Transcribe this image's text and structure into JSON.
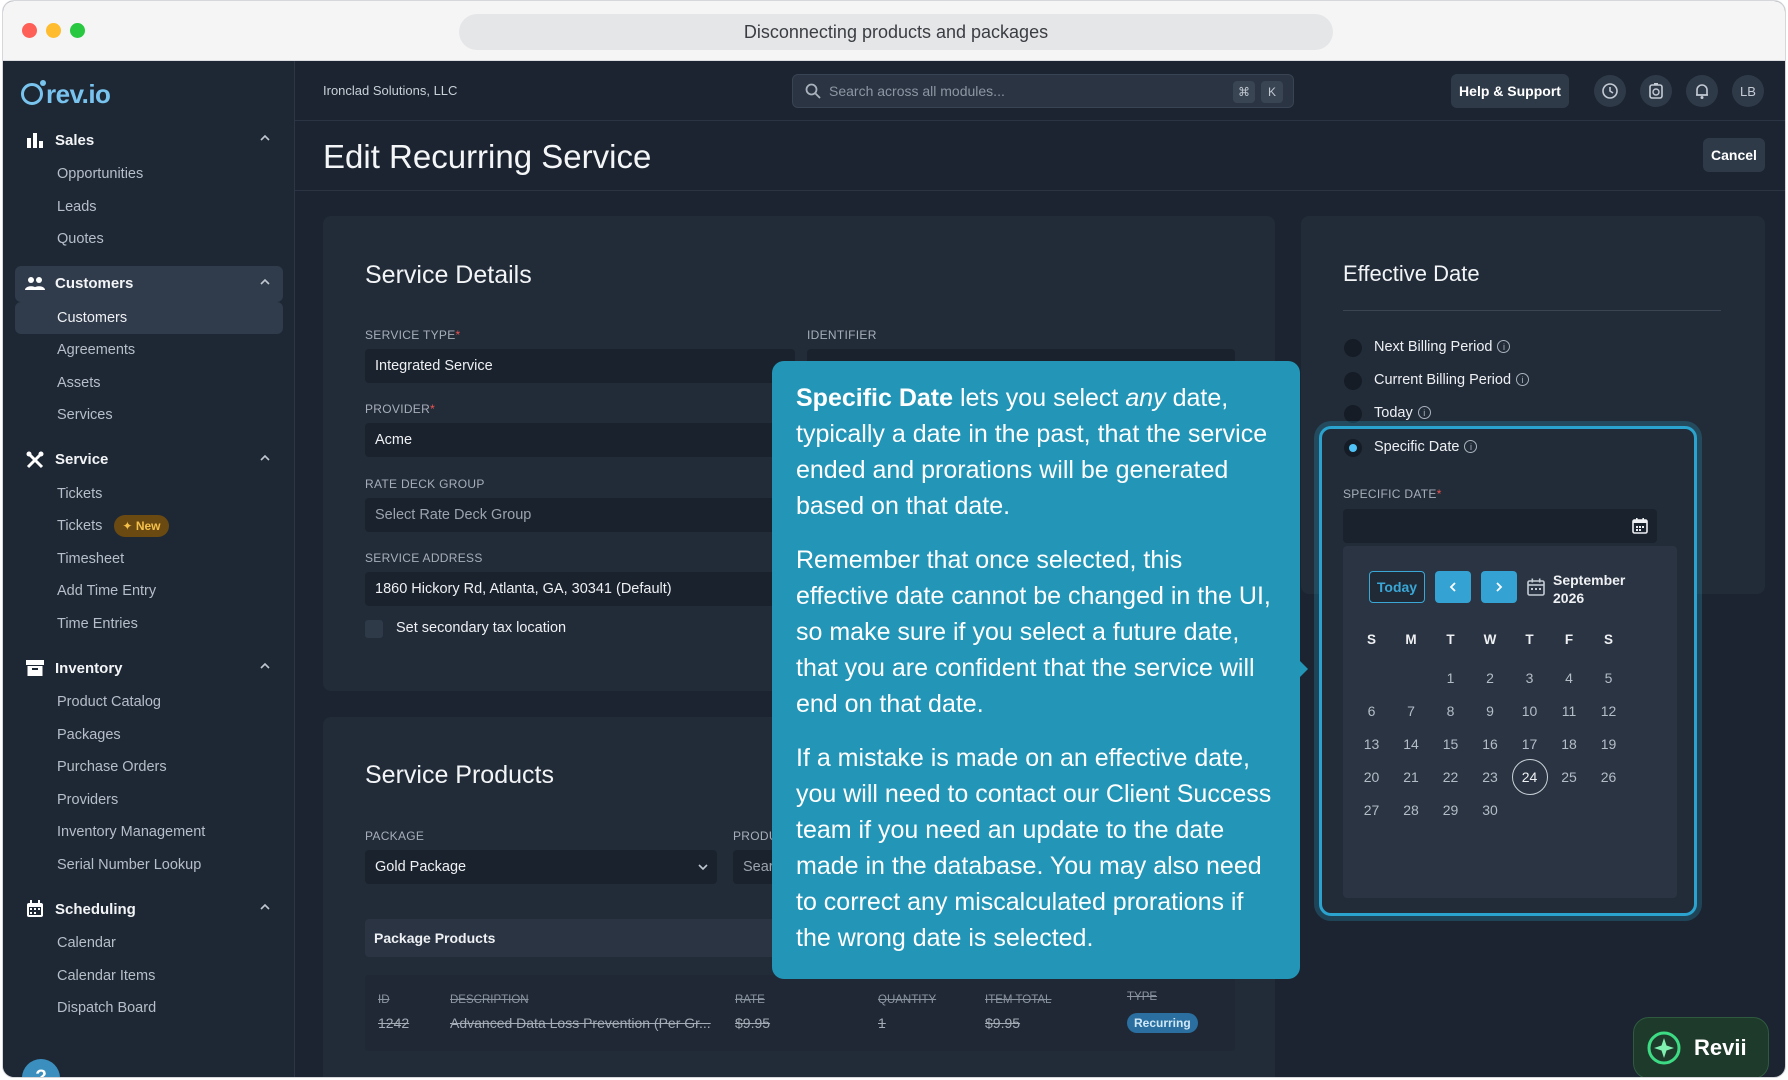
{
  "window": {
    "url_title": "Disconnecting products and packages"
  },
  "brand": {
    "logo": "rev.io",
    "accent": "#79c4ee"
  },
  "topbar": {
    "company": "Ironclad Solutions, LLC",
    "search_placeholder": "Search across all modules...",
    "kbd_cmd": "⌘",
    "kbd_k": "K",
    "help_label": "Help & Support",
    "avatar_initials": "LB"
  },
  "sidebar": {
    "sales": {
      "label": "Sales",
      "items": [
        "Opportunities",
        "Leads",
        "Quotes"
      ]
    },
    "customers": {
      "label": "Customers",
      "items": [
        "Customers",
        "Agreements",
        "Assets",
        "Services"
      ]
    },
    "service": {
      "label": "Service",
      "items": [
        "Tickets",
        "Tickets",
        "Timesheet",
        "Add Time Entry",
        "Time Entries"
      ],
      "new_badge": "New"
    },
    "inventory": {
      "label": "Inventory",
      "items": [
        "Product Catalog",
        "Packages",
        "Purchase Orders",
        "Providers",
        "Inventory Management",
        "Serial Number Lookup"
      ]
    },
    "scheduling": {
      "label": "Scheduling",
      "items": [
        "Calendar",
        "Calendar Items",
        "Dispatch Board"
      ]
    },
    "help_fab": "?"
  },
  "page": {
    "title": "Edit Recurring Service",
    "cancel_label": "Cancel"
  },
  "service_details": {
    "title": "Service Details",
    "service_type_label": "SERVICE TYPE",
    "service_type_value": "Integrated Service",
    "identifier_label": "IDENTIFIER",
    "provider_label": "PROVIDER",
    "provider_value": "Acme",
    "rate_deck_label": "RATE DECK GROUP",
    "rate_deck_placeholder": "Select Rate Deck Group",
    "address_label": "SERVICE ADDRESS",
    "address_value": "1860 Hickory Rd, Atlanta, GA, 30341 (Default)",
    "secondary_tax_label": "Set secondary tax location",
    "required_mark": "*"
  },
  "service_products": {
    "title": "Service Products",
    "package_label": "PACKAGE",
    "package_value": "Gold Package",
    "product_label": "PRODU",
    "product_placeholder": "Sear",
    "package_products_header": "Package Products",
    "columns": [
      "ID",
      "DESCRIPTION",
      "RATE",
      "QUANTITY",
      "ITEM TOTAL",
      "TYPE"
    ],
    "row": {
      "id": "1242",
      "description": "Advanced Data Loss Prevention (Per Gr...",
      "rate": "$9.95",
      "quantity": "1",
      "item_total": "$9.95",
      "type": "Recurring"
    }
  },
  "effective_date": {
    "title": "Effective Date",
    "options": [
      "Next Billing Period",
      "Current Billing Period",
      "Today",
      "Specific Date"
    ],
    "selected": "Specific Date",
    "info_glyph": "i",
    "specific_date_label": "SPECIFIC DATE",
    "calendar": {
      "today_label": "Today",
      "month": "September",
      "year": "2026",
      "weekdays": [
        "S",
        "M",
        "T",
        "W",
        "T",
        "F",
        "S"
      ],
      "first_weekday_index": 2,
      "days_in_month": 30,
      "selected_day": 24
    }
  },
  "tooltip": {
    "p1_bold": "Specific Date",
    "p1_a": " lets you select ",
    "p1_em": "any",
    "p1_b": " date, typically a date in the past, that the service ended and prorations will be generated based on that date.",
    "p2": "Remember that once selected, this effective date cannot be changed in the UI, so make sure if you select a future date, that you are confident that the service will end on that date.",
    "p3": "If a mistake is made on an effective date, you will need to contact our Client Success team if you need an update to the date made in the database. You may also need to correct any miscalculated prorations if the wrong date is selected."
  },
  "assistant": {
    "label": "Revii"
  }
}
